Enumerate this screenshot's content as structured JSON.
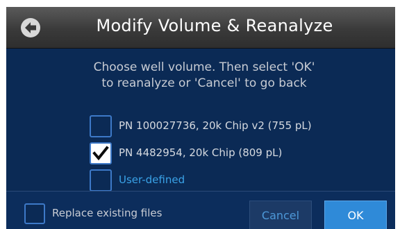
{
  "header": {
    "title": "Modify Volume & Reanalyze",
    "back_icon": "back-arrow-icon"
  },
  "instruction": {
    "line1": "Choose well volume. Then select 'OK'",
    "line2": "to reanalyze or 'Cancel' to go back"
  },
  "options": [
    {
      "label": "PN 100027736, 20k Chip v2 (755 pL)",
      "checked": false
    },
    {
      "label": "PN 4482954, 20k Chip (809 pL)",
      "checked": true
    },
    {
      "label": "User-defined",
      "checked": false
    }
  ],
  "footer": {
    "replace_label": "Replace existing files",
    "replace_checked": false,
    "cancel_label": "Cancel",
    "ok_label": "OK"
  },
  "colors": {
    "background": "#0b2a55",
    "accent": "#2f8ad8",
    "link": "#3aa3e8",
    "checkbox_border": "#3d79c8"
  }
}
